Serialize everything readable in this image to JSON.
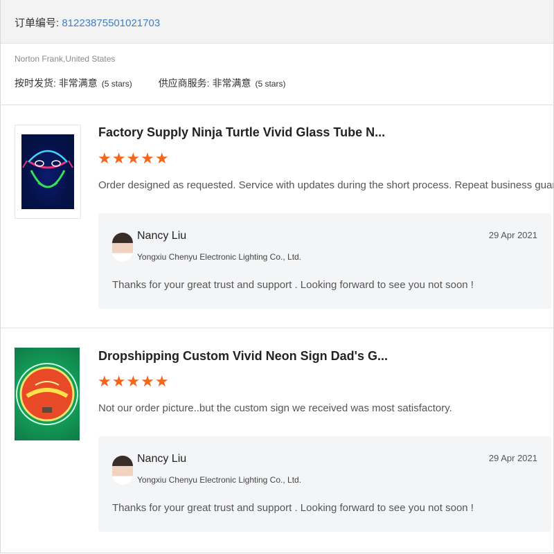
{
  "order": {
    "label": "订单编号: ",
    "number": "81223875501021703"
  },
  "buyer": {
    "name_location": "Norton Frank,United States"
  },
  "ratings": [
    {
      "label": "按时发货: 非常满意",
      "note": "(5 stars)",
      "stars": 5
    },
    {
      "label": "供应商服务: 非常满意",
      "note": "(5 stars)",
      "stars": 5
    }
  ],
  "reviews": [
    {
      "title": "Factory Supply Ninja Turtle Vivid Glass Tube N...",
      "stars": "★★★★★",
      "rating": 5,
      "comment": "Order designed as requested. Service with updates during the short process. Repeat business guaranteed.",
      "reply": {
        "name": "Nancy Liu",
        "company": "Yongxiu Chenyu Electronic Lighting Co., Ltd.",
        "date": "29 Apr 2021",
        "text": "Thanks for your great trust and support . Looking forward to see you not soon !"
      }
    },
    {
      "title": "Dropshipping Custom Vivid Neon Sign Dad's G...",
      "stars": "★★★★★",
      "rating": 5,
      "comment": "Not our order picture..but the custom sign we received was most satisfactory.",
      "reply": {
        "name": "Nancy Liu",
        "company": "Yongxiu Chenyu Electronic Lighting Co., Ltd.",
        "date": "29 Apr 2021",
        "text": "Thanks for your great trust and support . Looking forward to see you not soon !"
      }
    }
  ],
  "colors": {
    "accent_link": "#3d7fc8",
    "star": "#f4661b",
    "reply_bg": "#f4f5f7"
  }
}
